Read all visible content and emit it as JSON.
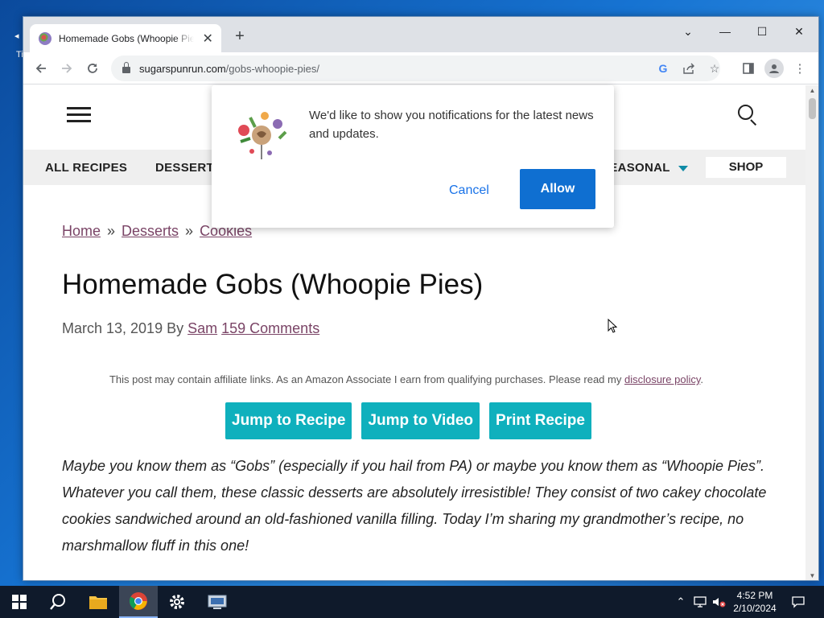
{
  "desktop": {
    "frag_top": "◂",
    "frag_bottom": "Ti"
  },
  "browser": {
    "tab_title": "Homemade Gobs (Whoopie Pies)",
    "tab_close": "✕",
    "new_tab": "+",
    "url_domain": "sugarspunrun.com",
    "url_path": "/gobs-whoopie-pies/",
    "controls": {
      "dropdown": "⌄",
      "minimize": "—",
      "maximize": "☐",
      "close": "✕"
    },
    "icons": [
      "back-icon",
      "forward-icon",
      "reload-icon",
      "lock-icon",
      "google-lens-icon",
      "share-icon",
      "star-icon",
      "side-panel-icon",
      "profile-icon",
      "menu-dots-icon"
    ]
  },
  "site": {
    "menu": {
      "all_recipes": "ALL RECIPES",
      "desserts": "DESSERTS",
      "seasonal": "SEASONAL",
      "shop": "SHOP"
    },
    "breadcrumb": {
      "home": "Home",
      "desserts": "Desserts",
      "cookies": "Cookies",
      "sep": "»"
    },
    "title": "Homemade Gobs (Whoopie Pies)",
    "meta": {
      "date": "March 13, 2019 By",
      "author": "Sam",
      "comments": "159 Comments"
    },
    "disclaimer": {
      "text": "This post may contain affiliate links. As an Amazon Associate I earn from qualifying purchases. Please read my",
      "link": "disclosure policy",
      "end": "."
    },
    "buttons": {
      "jump_recipe": "Jump to Recipe",
      "jump_video": "Jump to Video",
      "print_recipe": "Print Recipe"
    },
    "intro": "Maybe you know them as “Gobs” (especially if you hail from PA) or maybe you know them as “Whoopie Pies”. Whatever you call them, these classic desserts are absolutely irresistible! They consist of two cakey chocolate cookies sandwiched around an old-fashioned vanilla filling. Today I’m sharing my grandmother’s recipe, no marshmallow fluff in this one!"
  },
  "notification": {
    "message": "We'd like to show you notifications for the latest news and updates.",
    "cancel": "Cancel",
    "allow": "Allow"
  },
  "taskbar": {
    "time": "4:52 PM",
    "date": "2/10/2024"
  },
  "colors": {
    "accent_teal": "#0fb0bd",
    "link_purple": "#7a4466",
    "allow_blue": "#0f6fd1"
  }
}
